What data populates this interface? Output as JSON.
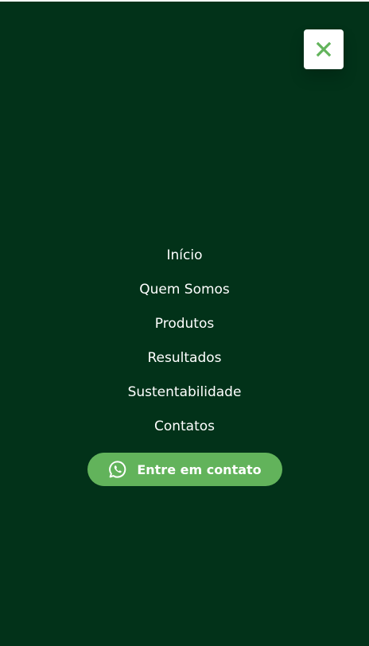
{
  "menu": {
    "items": [
      {
        "label": "Início"
      },
      {
        "label": "Quem Somos"
      },
      {
        "label": "Produtos"
      },
      {
        "label": "Resultados"
      },
      {
        "label": "Sustentabilidade"
      },
      {
        "label": "Contatos"
      }
    ],
    "cta": {
      "label": "Entre em contato",
      "icon": "whatsapp-icon"
    },
    "close": {
      "icon": "close-icon"
    }
  },
  "colors": {
    "overlay_background": "#023219",
    "accent_green": "#62b35b",
    "close_background": "#ffffff",
    "text": "#ffffff"
  }
}
